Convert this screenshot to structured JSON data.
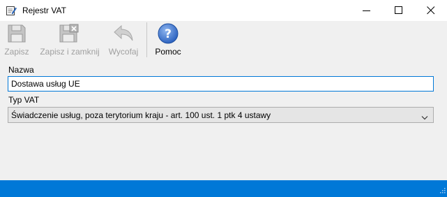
{
  "window": {
    "title": "Rejestr VAT"
  },
  "toolbar": {
    "save_label": "Zapisz",
    "save_close_label": "Zapisz i zamknij",
    "undo_label": "Wycofaj",
    "help_label": "Pomoc"
  },
  "form": {
    "name_label": "Nazwa",
    "name_value": "Dostawa usług UE",
    "vat_type_label": "Typ VAT",
    "vat_type_value": "Świadczenie usług, poza terytorium kraju - art. 100 ust. 1 ptk 4 ustawy"
  },
  "colors": {
    "accent": "#0078d7",
    "help_icon": "#3b73c8",
    "disabled": "#a0a0a0"
  },
  "icons": [
    "notepad-icon",
    "floppy-disk-icon",
    "floppy-disk-close-icon",
    "undo-arrow-icon",
    "help-question-icon",
    "chevron-down-icon",
    "resize-grip-icon"
  ]
}
